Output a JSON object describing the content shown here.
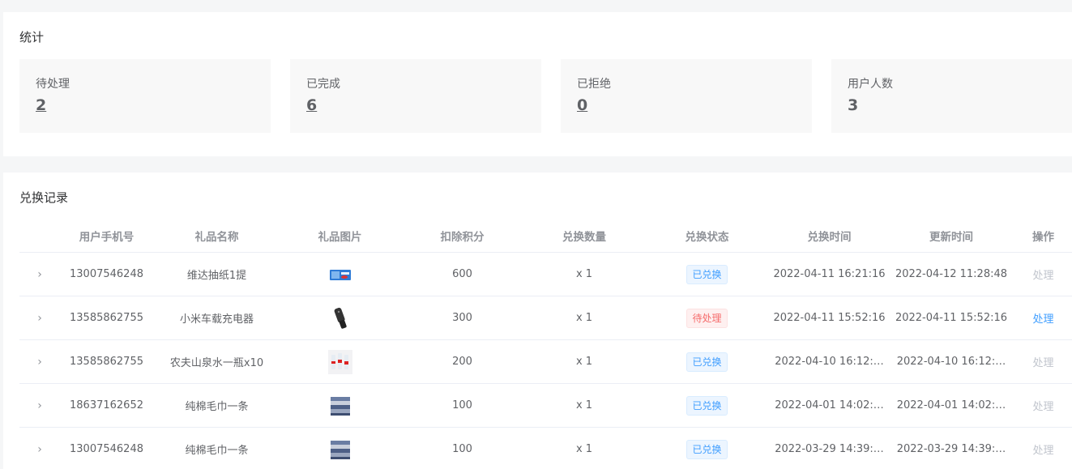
{
  "stats": {
    "title": "统计",
    "items": [
      {
        "label": "待处理",
        "value": "2",
        "link": true
      },
      {
        "label": "已完成",
        "value": "6",
        "link": true
      },
      {
        "label": "已拒绝",
        "value": "0",
        "link": true
      },
      {
        "label": "用户人数",
        "value": "3",
        "link": false
      }
    ]
  },
  "records": {
    "title": "兑换记录",
    "columns": [
      "用户手机号",
      "礼品名称",
      "礼品图片",
      "扣除积分",
      "兑换数量",
      "兑换状态",
      "兑换时间",
      "更新时间",
      "操作"
    ],
    "rows": [
      {
        "phone": "13007546248",
        "gift": "维达抽纸1提",
        "image": "tissue-box",
        "points": "600",
        "qty": "x 1",
        "status": "已兑换",
        "status_type": "done",
        "exchange_time": "2022-04-11 16:21:16",
        "update_time": "2022-04-12 11:28:48",
        "action": "处理",
        "action_active": false
      },
      {
        "phone": "13585862755",
        "gift": "小米车载充电器",
        "image": "car-charger",
        "points": "300",
        "qty": "x 1",
        "status": "待处理",
        "status_type": "pending",
        "exchange_time": "2022-04-11 15:52:16",
        "update_time": "2022-04-11 15:52:16",
        "action": "处理",
        "action_active": true
      },
      {
        "phone": "13585862755",
        "gift": "农夫山泉水一瓶x10",
        "image": "water-bottles",
        "points": "200",
        "qty": "x 1",
        "status": "已兑换",
        "status_type": "done",
        "exchange_time": "2022-04-10 16:12:…",
        "update_time": "2022-04-10 16:12:…",
        "action": "处理",
        "action_active": false
      },
      {
        "phone": "18637162652",
        "gift": "纯棉毛巾一条",
        "image": "towel",
        "points": "100",
        "qty": "x 1",
        "status": "已兑换",
        "status_type": "done",
        "exchange_time": "2022-04-01 14:02:…",
        "update_time": "2022-04-01 14:02:…",
        "action": "处理",
        "action_active": false
      },
      {
        "phone": "13007546248",
        "gift": "纯棉毛巾一条",
        "image": "towel",
        "points": "100",
        "qty": "x 1",
        "status": "已兑换",
        "status_type": "done",
        "exchange_time": "2022-03-29 14:39:…",
        "update_time": "2022-03-29 14:39:…",
        "action": "处理",
        "action_active": false
      }
    ]
  },
  "colors": {
    "primary": "#409eff",
    "danger": "#f56c6c",
    "muted": "#c0c4cc"
  }
}
